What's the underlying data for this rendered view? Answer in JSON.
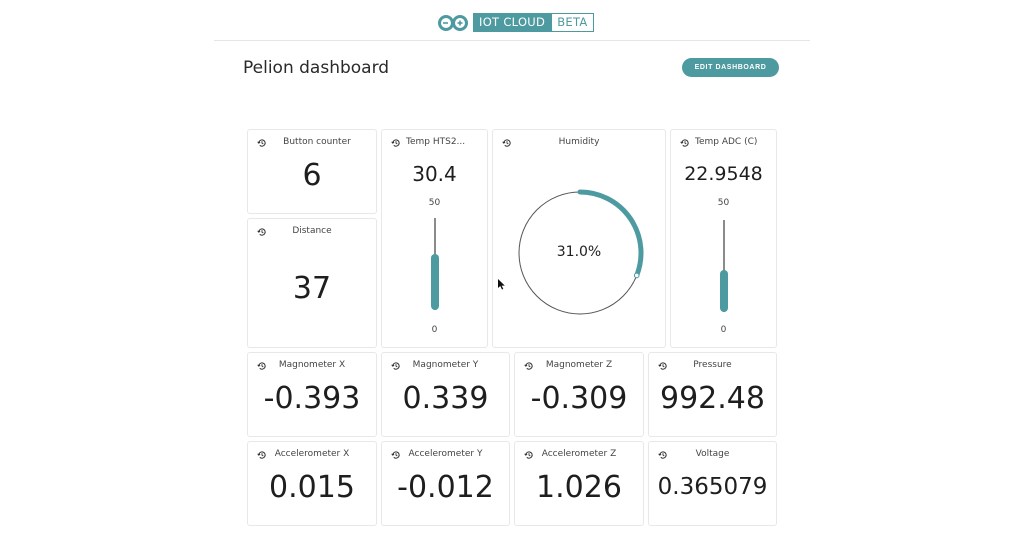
{
  "header": {
    "logo_main": "IOT CLOUD",
    "logo_badge": "BETA"
  },
  "page": {
    "title": "Pelion dashboard",
    "edit_button": "EDIT DASHBOARD"
  },
  "colors": {
    "accent": "#4e9aa1"
  },
  "widgets": {
    "button_counter": {
      "title": "Button counter",
      "value": "6"
    },
    "distance": {
      "title": "Distance",
      "value": "37"
    },
    "temp_hts": {
      "title": "Temp HTS2...",
      "value": "30.4",
      "max": "50",
      "min": "0",
      "level_fraction": 0.608
    },
    "humidity": {
      "title": "Humidity",
      "value": "31.0%",
      "fraction": 0.31
    },
    "temp_adc": {
      "title": "Temp ADC (C)",
      "value": "22.9548",
      "max": "50",
      "min": "0",
      "level_fraction": 0.459
    },
    "mag_x": {
      "title": "Magnometer X",
      "value": "-0.393"
    },
    "mag_y": {
      "title": "Magnometer Y",
      "value": "0.339"
    },
    "mag_z": {
      "title": "Magnometer Z",
      "value": "-0.309"
    },
    "pressure": {
      "title": "Pressure",
      "value": "992.48"
    },
    "acc_x": {
      "title": "Accelerometer X",
      "value": "0.015"
    },
    "acc_y": {
      "title": "Accelerometer Y",
      "value": "-0.012"
    },
    "acc_z": {
      "title": "Accelerometer Z",
      "value": "1.026"
    },
    "voltage": {
      "title": "Voltage",
      "value": "0.365079"
    }
  }
}
